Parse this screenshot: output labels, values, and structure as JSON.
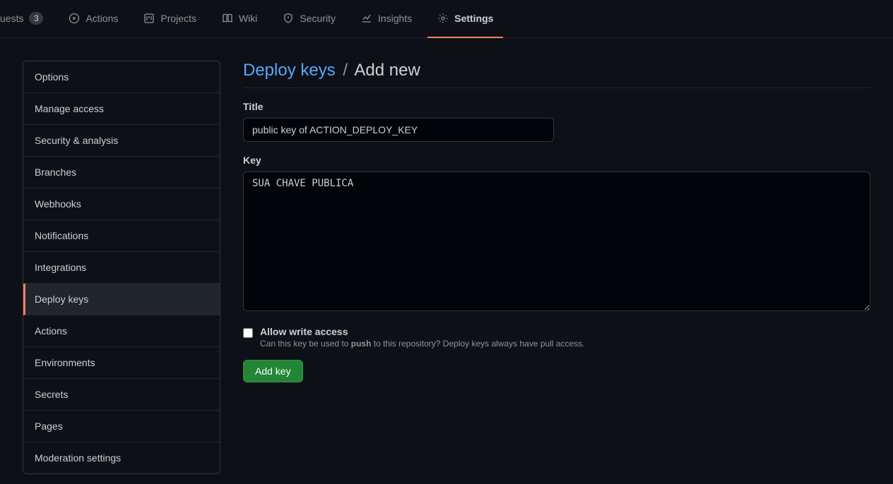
{
  "topnav": {
    "tabs": [
      {
        "id": "pulls",
        "label": "uests",
        "count": "3",
        "active": false
      },
      {
        "id": "actions",
        "label": "Actions",
        "active": false
      },
      {
        "id": "projects",
        "label": "Projects",
        "active": false
      },
      {
        "id": "wiki",
        "label": "Wiki",
        "active": false
      },
      {
        "id": "security",
        "label": "Security",
        "active": false
      },
      {
        "id": "insights",
        "label": "Insights",
        "active": false
      },
      {
        "id": "settings",
        "label": "Settings",
        "active": true
      }
    ]
  },
  "sidebar": {
    "items": [
      {
        "label": "Options"
      },
      {
        "label": "Manage access"
      },
      {
        "label": "Security & analysis"
      },
      {
        "label": "Branches"
      },
      {
        "label": "Webhooks"
      },
      {
        "label": "Notifications"
      },
      {
        "label": "Integrations"
      },
      {
        "label": "Deploy keys",
        "selected": true
      },
      {
        "label": "Actions"
      },
      {
        "label": "Environments"
      },
      {
        "label": "Secrets"
      },
      {
        "label": "Pages"
      },
      {
        "label": "Moderation settings"
      }
    ]
  },
  "breadcrumb": {
    "parent": "Deploy keys",
    "sep": "/",
    "current": "Add new"
  },
  "form": {
    "title_label": "Title",
    "title_value": "public key of ACTION_DEPLOY_KEY",
    "key_label": "Key",
    "key_value": "SUA CHAVE PUBLICA",
    "allow_write_label": "Allow write access",
    "allow_write_checked": false,
    "allow_write_help_pre": "Can this key be used to ",
    "allow_write_help_strong": "push",
    "allow_write_help_post": " to this repository? Deploy keys always have pull access.",
    "submit_label": "Add key"
  }
}
